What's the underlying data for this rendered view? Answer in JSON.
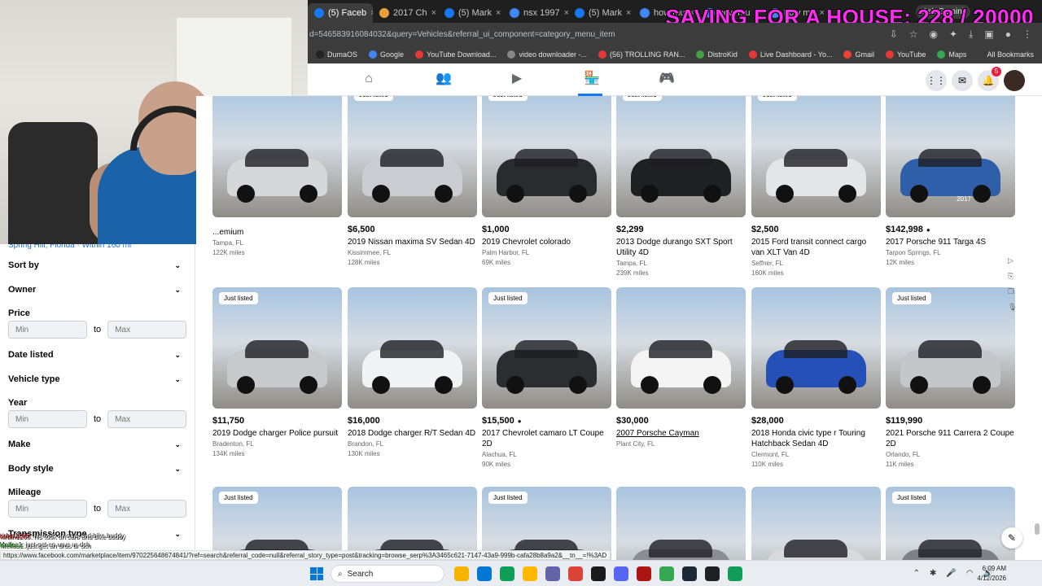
{
  "overlay": {
    "text": "SAVING FOR A HOUSE: 228 / 20000"
  },
  "browser": {
    "tabs": [
      {
        "label": "(5) Faceb",
        "active": true,
        "color": "#1877f2"
      },
      {
        "label": "2017 Ch",
        "active": false,
        "color": "#e8a13a"
      },
      {
        "label": "(5) Mark",
        "active": false,
        "color": "#1877f2"
      },
      {
        "label": "nsx 1997",
        "active": false,
        "color": "#4285f4"
      },
      {
        "label": "(5) Mark",
        "active": false,
        "color": "#1877f2"
      },
      {
        "label": "how mu",
        "active": false,
        "color": "#4285f4"
      },
      {
        "label": "how mu",
        "active": false,
        "color": "#4285f4"
      },
      {
        "label": "how mu",
        "active": false,
        "color": "#4285f4"
      }
    ],
    "gemini_label": "Ask Gemini",
    "url": "d=546583916084032&query=Vehicles&referral_ui_component=category_menu_item",
    "bookmarks": [
      {
        "label": "DumaOS",
        "color": "#222"
      },
      {
        "label": "Google",
        "color": "#4285f4"
      },
      {
        "label": "YouTube Download...",
        "color": "#e53935"
      },
      {
        "label": "video downloader -...",
        "color": "#888"
      },
      {
        "label": "(56) TROLLING RAN...",
        "color": "#e53935"
      },
      {
        "label": "DistroKid",
        "color": "#43a047"
      },
      {
        "label": "Live Dashboard - Yo...",
        "color": "#e53935"
      },
      {
        "label": "Gmail",
        "color": "#ea4335"
      },
      {
        "label": "YouTube",
        "color": "#e53935"
      },
      {
        "label": "Maps",
        "color": "#34a853"
      }
    ],
    "all_bookmarks": "All Bookmarks"
  },
  "fb": {
    "notifications_count": "5"
  },
  "sidebar": {
    "location": "Spring Hill, Florida · Within 160 mi",
    "sort_by": "Sort by",
    "owner": "Owner",
    "price": "Price",
    "date_listed": "Date listed",
    "vehicle_type": "Vehicle type",
    "year": "Year",
    "make": "Make",
    "body_style": "Body style",
    "mileage": "Mileage",
    "transmission_type": "Transmission type",
    "min_placeholder": "Min",
    "max_placeholder": "Max",
    "to": "to"
  },
  "listings": [
    {
      "price": "",
      "title": "...emium",
      "location": "Tampa, FL",
      "miles": "122K miles",
      "just_listed": false,
      "color": "#d5d7d9"
    },
    {
      "price": "$6,500",
      "title": "2019 Nissan maxima SV Sedan 4D",
      "location": "Kissimmee, FL",
      "miles": "128K miles",
      "just_listed": true,
      "color": "#c9ccd0"
    },
    {
      "price": "$1,000",
      "title": "2019 Chevrolet colorado",
      "location": "Palm Harbor, FL",
      "miles": "69K miles",
      "just_listed": true,
      "color": "#2a2b2e"
    },
    {
      "price": "$2,299",
      "title": "2013 Dodge durango SXT Sport Utility 4D",
      "location": "Tampa, FL",
      "miles": "239K miles",
      "just_listed": true,
      "color": "#1f2022"
    },
    {
      "price": "$2,500",
      "title": "2015 Ford transit connect cargo van XLT Van 4D",
      "location": "Seffner, FL",
      "miles": "160K miles",
      "just_listed": true,
      "color": "#e4e5e7"
    },
    {
      "price": "$142,998",
      "title": "2017 Porsche 911 Targa 4S",
      "location": "Tarpon Springs, FL",
      "miles": "12K miles",
      "just_listed": false,
      "color": "#2f5fa8",
      "messenger": true,
      "stamp": "2017"
    },
    {
      "price": "$11,750",
      "title": "2019 Dodge charger Police pursuit",
      "location": "Bradenton, FL",
      "miles": "134K miles",
      "just_listed": true,
      "color": "#c7c9cc"
    },
    {
      "price": "$16,000",
      "title": "2018 Dodge charger R/T Sedan 4D",
      "location": "Brandon, FL",
      "miles": "130K miles",
      "just_listed": false,
      "color": "#f1f2f3"
    },
    {
      "price": "$15,500",
      "title": "2017 Chevrolet camaro LT Coupe 2D",
      "location": "Alachua, FL",
      "miles": "90K miles",
      "just_listed": true,
      "color": "#2c2d30",
      "messenger": true
    },
    {
      "price": "$30,000",
      "title": "2007 Porsche Cayman",
      "location": "Plant City, FL",
      "miles": "",
      "just_listed": false,
      "color": "#f4f4f4",
      "hover": true
    },
    {
      "price": "$28,000",
      "title": "2018 Honda civic type r Touring Hatchback Sedan 4D",
      "location": "Clermont, FL",
      "miles": "110K miles",
      "just_listed": false,
      "color": "#2450b8"
    },
    {
      "price": "$119,990",
      "title": "2021 Porsche 911 Carrera 2 Coupe 2D",
      "location": "Orlando, FL",
      "miles": "11K miles",
      "just_listed": true,
      "color": "#c4c6ca"
    },
    {
      "price": "",
      "title": "",
      "location": "",
      "miles": "",
      "just_listed": true,
      "color": "#233a78"
    },
    {
      "price": "",
      "title": "",
      "location": "",
      "miles": "",
      "just_listed": false,
      "color": "#3a3b3e"
    },
    {
      "price": "",
      "title": "",
      "location": "",
      "miles": "",
      "just_listed": true,
      "color": "#4a4b4e"
    },
    {
      "price": "",
      "title": "",
      "location": "",
      "miles": "",
      "just_listed": false,
      "color": "#8a8d92"
    },
    {
      "price": "",
      "title": "",
      "location": "",
      "miles": "",
      "just_listed": false,
      "color": "#d9dadc"
    },
    {
      "price": "",
      "title": "",
      "location": "",
      "miles": "",
      "just_listed": true,
      "color": "#7d8084"
    }
  ],
  "just_listed_label": "Just listed",
  "status_url": "https://www.facebook.com/marketplace/item/970225648674841/?ref=search&referral_code=null&referral_story_type=post&tracking=browse_serp%3A3465c621-7147-43a9-999b-cafa28b8a9a2&__tn__=!%3AD",
  "chat": [
    {
      "user": "kirbin1265",
      "msg": ": his took on cars and bike buddy",
      "cls": "u1"
    },
    {
      "user": "Melfas1",
      "msg": ": just get an urus ur dch",
      "cls": "u2"
    },
    {
      "user": "Bigmacco",
      "msg": ": buy a hand cruiser",
      "cls": "u3"
    },
    {
      "user": "Muteuser2",
      "msg": ": 😭",
      "cls": "u4"
    }
  ],
  "taskbar": {
    "search": "Search",
    "time": "6:09 AM",
    "date": "4/12/2026",
    "apps": [
      "#f4b400",
      "#0078d4",
      "#0f9d58",
      "#ffb900",
      "#6264a7",
      "#db4437",
      "#1a1a1a",
      "#5865f2",
      "#ad1414",
      "#34a853",
      "#1b2838",
      "#202124",
      "#0f9d58"
    ]
  }
}
